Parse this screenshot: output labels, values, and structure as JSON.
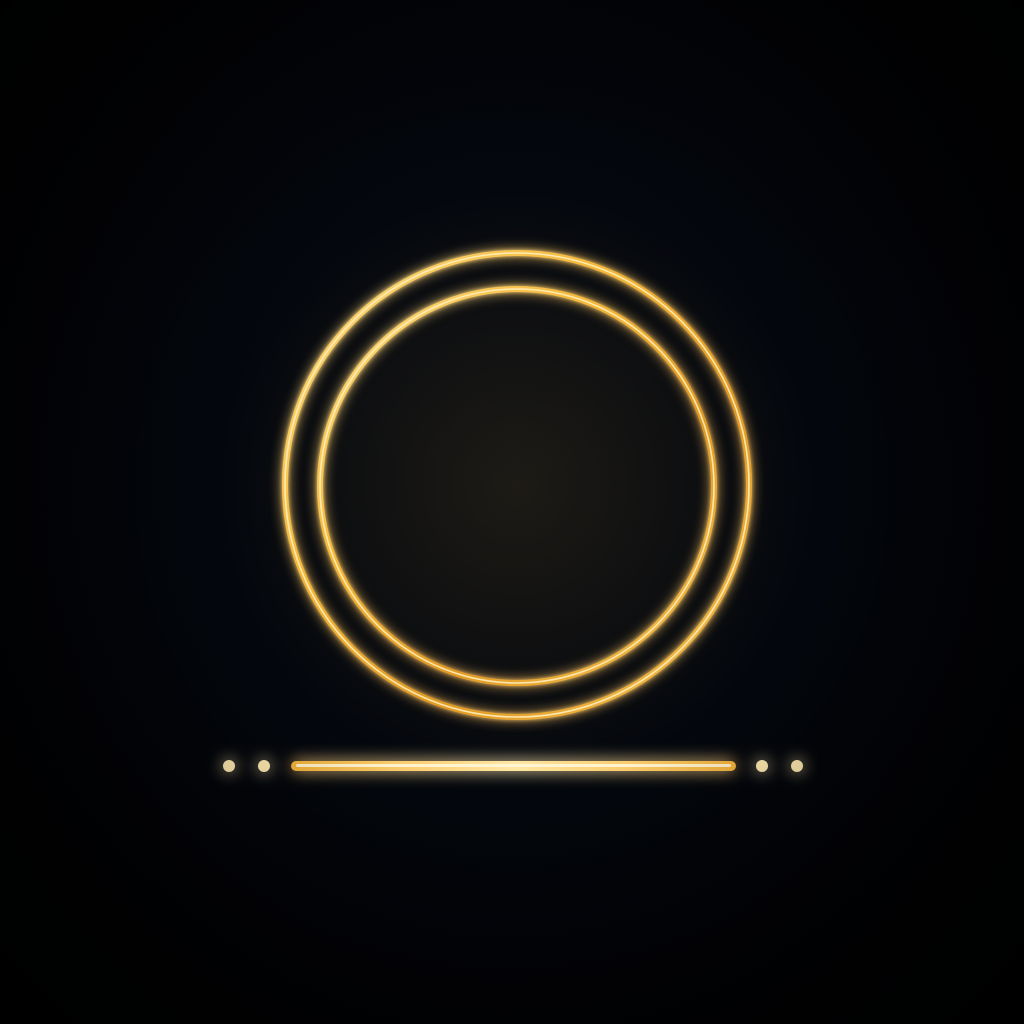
{
  "scene": {
    "background_color": "#000000",
    "glow_color": "#f0b43a",
    "highlight_color": "#ffe6a0",
    "outer_ring": {
      "icon": "outer-ring-icon"
    },
    "inner_ring": {
      "icon": "inner-ring-icon"
    },
    "baseline": {
      "icon": "horizontal-line-icon",
      "left_dots": 2,
      "right_dots": 2
    }
  }
}
